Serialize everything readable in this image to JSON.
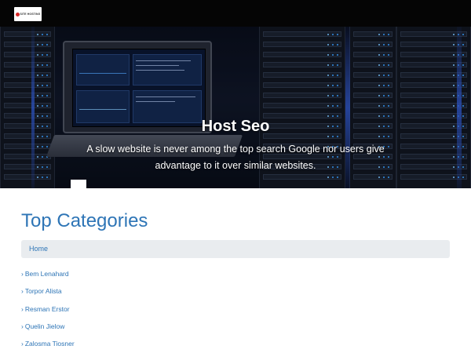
{
  "header": {
    "logo_text": "SITE HOSTING"
  },
  "hero": {
    "title": "Host Seo",
    "subtitle": "A slow website is never among the top search Google nor users give advantage to it over similar websites."
  },
  "main": {
    "section_title": "Top Categories",
    "breadcrumb": {
      "items": [
        "Home"
      ]
    },
    "categories": [
      {
        "arrow": "›",
        "label": "Bem Lenahard"
      },
      {
        "arrow": "›",
        "label": "Torpor Alista"
      },
      {
        "arrow": "›",
        "label": "Resman Erstor"
      },
      {
        "arrow": "›",
        "label": "Quelin Jielow"
      },
      {
        "arrow": "›",
        "label": "Zalosma Tiosner"
      }
    ]
  },
  "colors": {
    "top_bar": "#050505",
    "link_blue": "#2e75b6",
    "breadcrumb_bg": "#e9ecef"
  }
}
